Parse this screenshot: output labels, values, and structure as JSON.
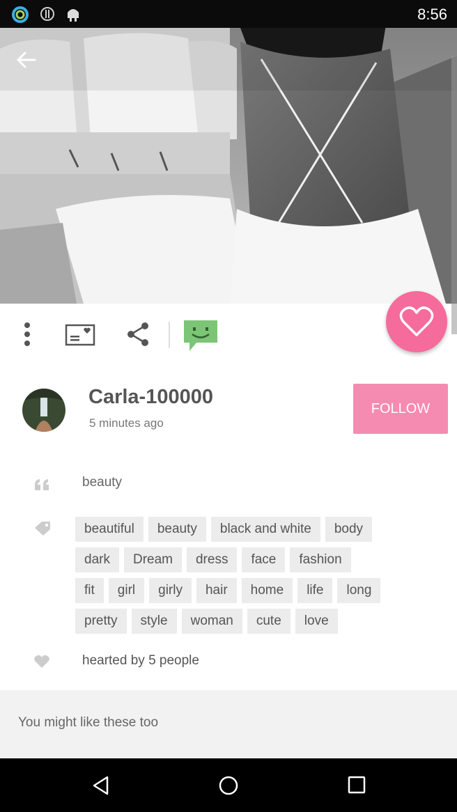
{
  "status_bar": {
    "time": "8:56",
    "icons": [
      "ring-icon",
      "info-icon",
      "android-icon"
    ]
  },
  "hero": {
    "image_description_icon": "photo-image",
    "back_icon": "arrow-left-icon"
  },
  "actions": {
    "items": [
      "more-vert-icon",
      "postcard-icon",
      "share-icon",
      "comment-icon"
    ],
    "heart_icon": "heart-outline-icon",
    "accent": "#f56b9b",
    "comment_color": "#7cc576"
  },
  "author": {
    "name": "Carla-100000",
    "time_ago": "5 minutes ago",
    "follow_label": "FOLLOW",
    "follow_color": "#f58bb0"
  },
  "post": {
    "caption": "beauty",
    "tag_rows": [
      [
        "beautiful",
        "beauty",
        "black and white",
        "body"
      ],
      [
        "dark",
        "Dream",
        "dress",
        "face",
        "fashion"
      ],
      [
        "fit",
        "girl",
        "girly",
        "hair",
        "home",
        "life",
        "long"
      ],
      [
        "pretty",
        "style",
        "woman",
        "cute",
        "love"
      ]
    ],
    "hearted_text": "hearted by 5 people"
  },
  "suggestions": {
    "title": "You might like these too"
  },
  "nav": {
    "items": [
      "back-triangle-icon",
      "home-circle-icon",
      "recents-square-icon"
    ]
  }
}
